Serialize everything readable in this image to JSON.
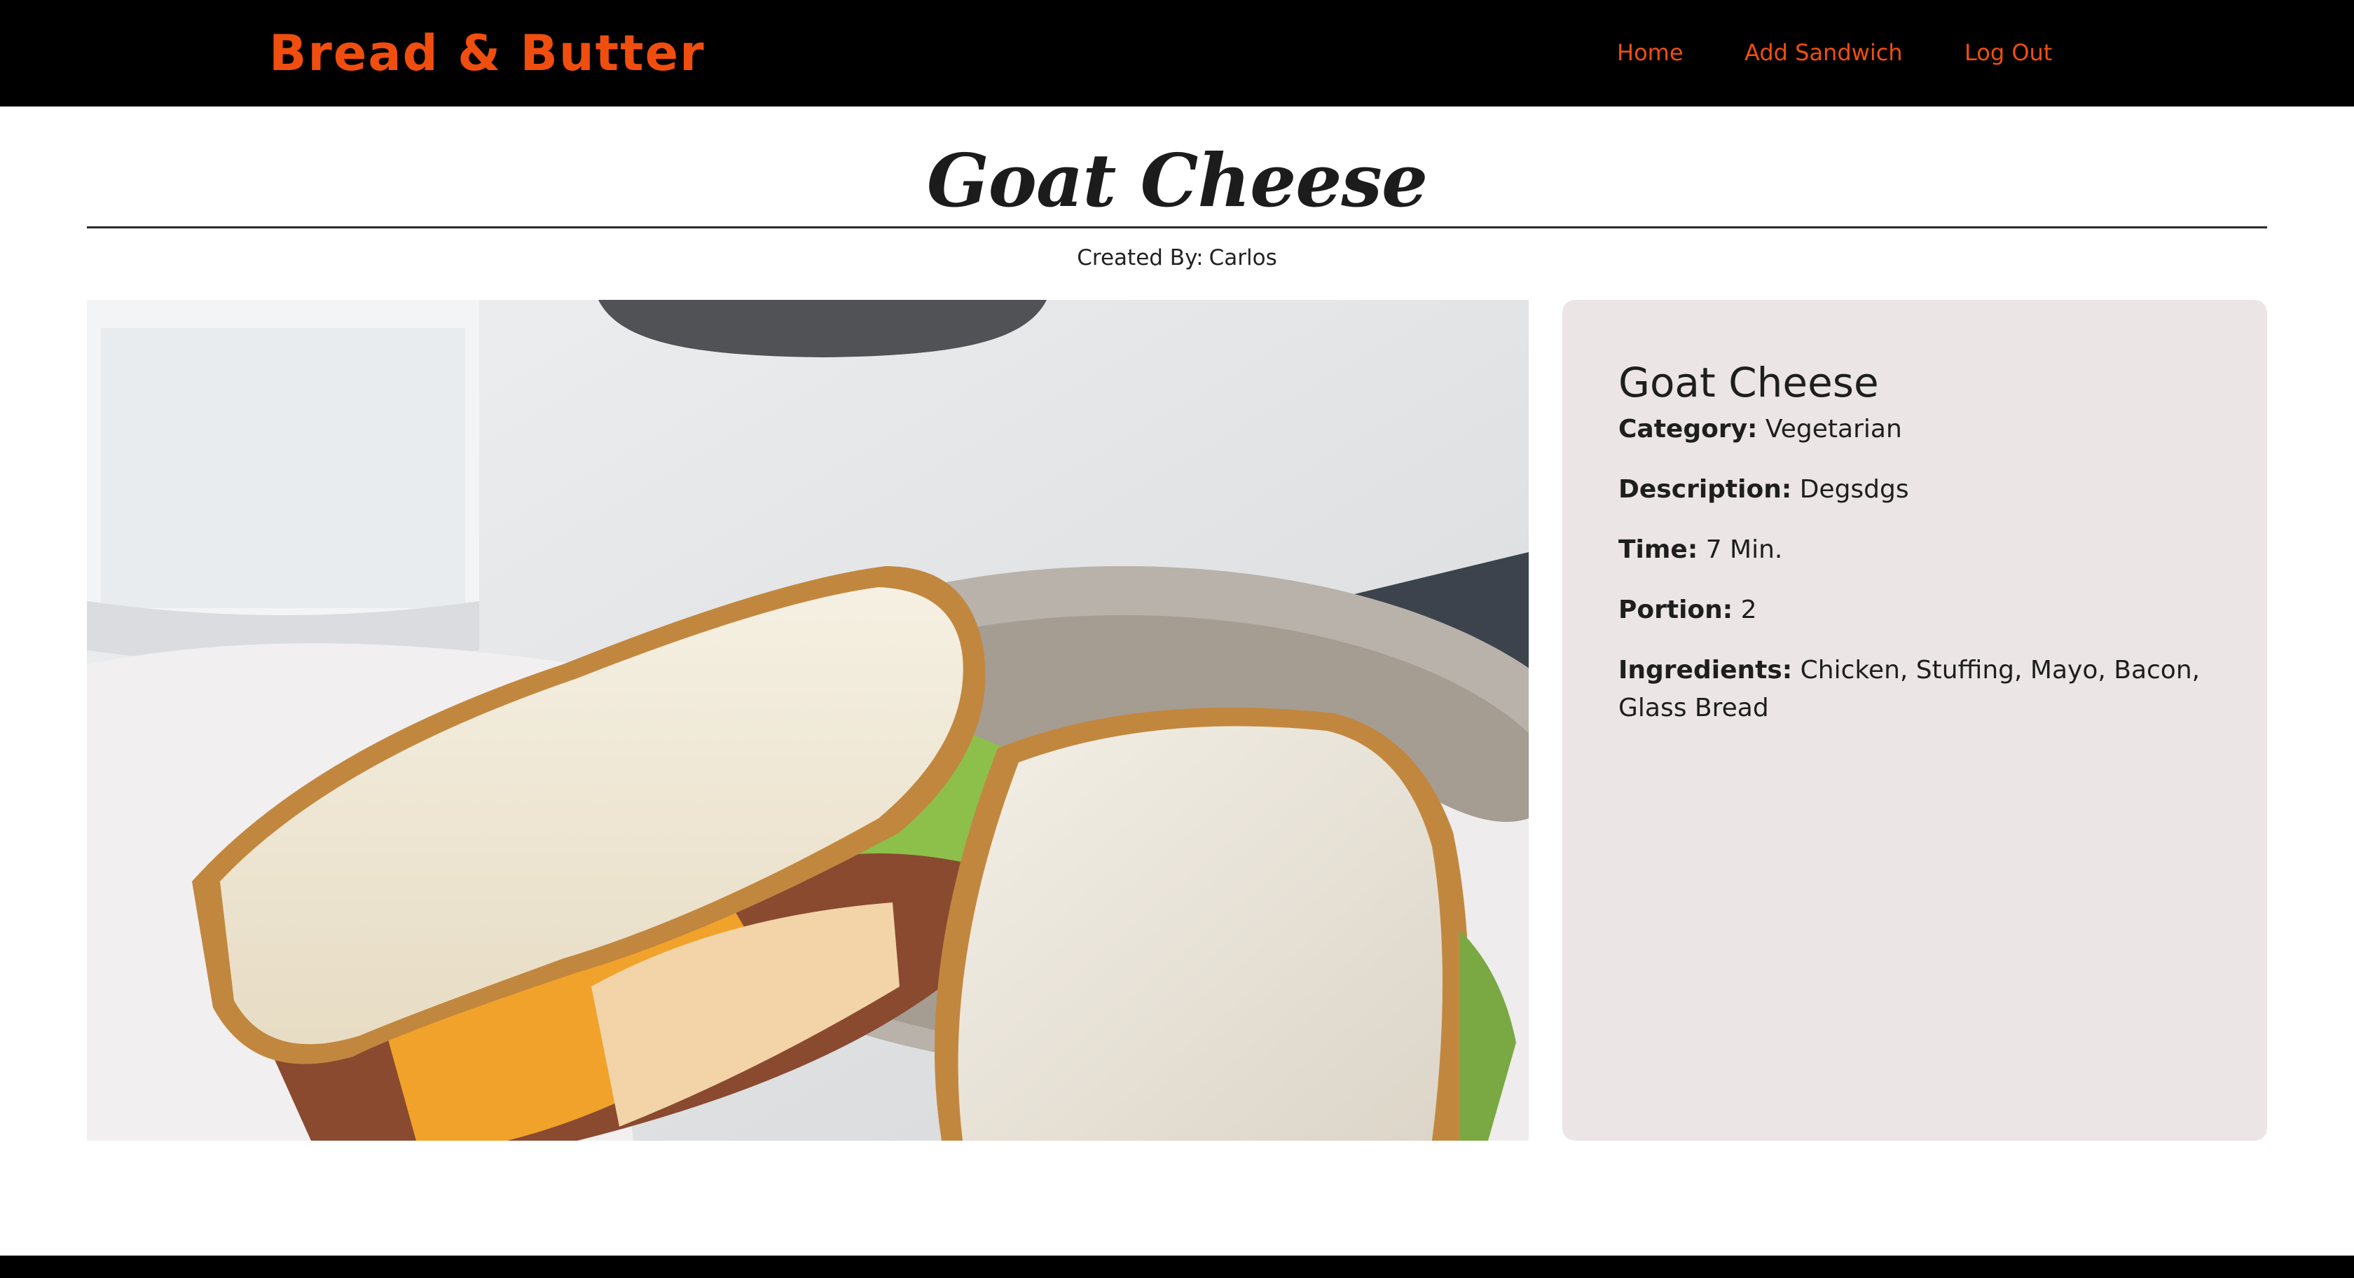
{
  "navbar": {
    "brand": "Bread & Butter",
    "links": [
      "Home",
      "Add Sandwich",
      "Log Out"
    ]
  },
  "sandwich": {
    "title": "Goat Cheese",
    "created_by_label": "Created By:",
    "created_by_name": "Carlos",
    "photo_icon": "sandwich-photo",
    "card": {
      "name": "Goat Cheese",
      "category_label": "Category:",
      "category": "Vegetarian",
      "description_label": "Description:",
      "description": "Degsdgs",
      "time_label": "Time:",
      "time": "7 Min.",
      "portion_label": "Portion:",
      "portion": "2",
      "ingredients_label": "Ingredients:",
      "ingredients": "Chicken, Stuffing, Mayo, Bacon, Glass Bread"
    }
  },
  "colors": {
    "accent": "#f04e0f",
    "navbar_bg": "#000000",
    "card_bg": "#ebe5e6",
    "text": "#1e1e1e"
  }
}
